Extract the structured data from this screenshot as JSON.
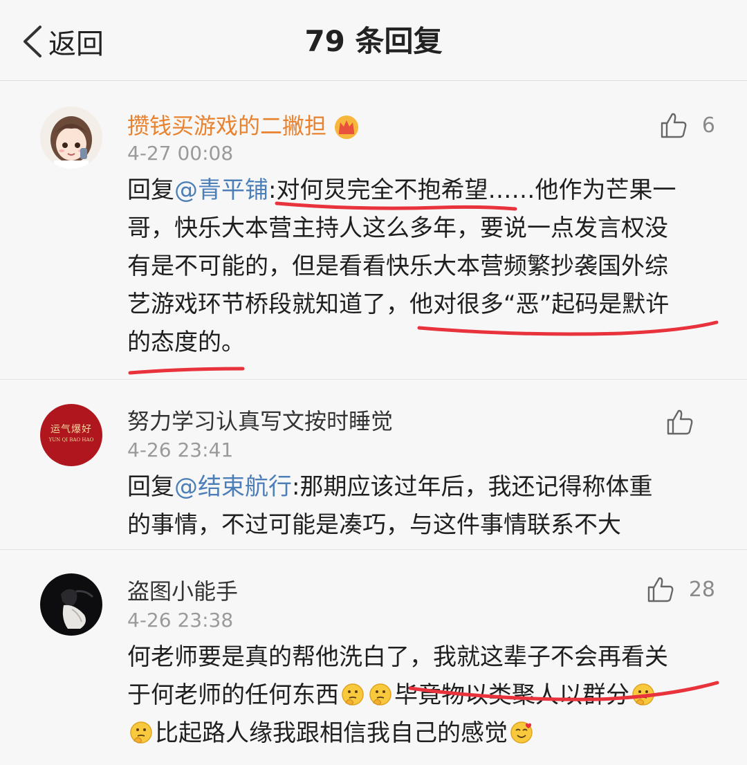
{
  "nav": {
    "back_label": "返回",
    "title": "79 条回复"
  },
  "comments": [
    {
      "username": "攒钱买游戏的二撇担",
      "time": "4-27 00:08",
      "likes": "6",
      "reply_prefix": "回复",
      "mention": "@青平铺",
      "text_a": ":对何炅完全不抱希望……他作为芒果一",
      "text_b": "哥，快乐大本营主持人这么多年，要说一点发言权没",
      "text_c": "有是不可能的，但是看看快乐大本营频繁抄袭国外综",
      "text_d": "艺游戏环节桥段就知道了，他对很多“恶”起码是默许",
      "text_e": "的态度的。"
    },
    {
      "username": "努力学习认真写文按时睡觉",
      "avatar_text": "运气爆好",
      "avatar_subtext": "YUN QI BAO HAO",
      "time": "4-26 23:41",
      "likes": "",
      "reply_prefix": "回复",
      "mention": "@结束航行",
      "text_a": ":那期应该过年后，我还记得称体重",
      "text_b": "的事情，不过可能是凑巧，与这件事情联系不大"
    },
    {
      "username": "盗图小能手",
      "time": "4-26 23:38",
      "likes": "28",
      "text_a": "何老师要是真的帮他洗白了，我就这辈子不会再看关",
      "text_b1": "于何老师的任何东西",
      "text_b2": "毕竟物以类聚人以群分",
      "text_c": "比起路人缘我跟相信我自己的感觉"
    }
  ],
  "colors": {
    "vip_name": "#e8822e",
    "mention": "#4c7fb8",
    "annotation": "#e8323c"
  }
}
